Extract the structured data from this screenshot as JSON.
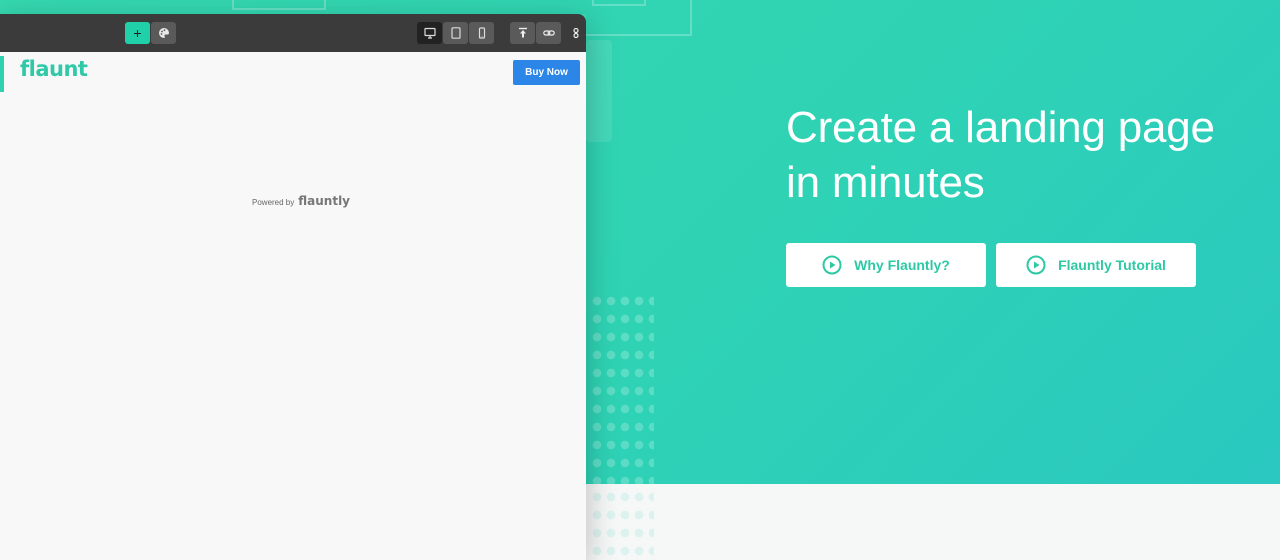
{
  "hero": {
    "headline_line1": "Create a landing page",
    "headline_line2": "in minutes",
    "buttons": [
      {
        "label": "Why Flauntly?",
        "icon": "play-circle-icon"
      },
      {
        "label": "Flauntly Tutorial",
        "icon": "play-circle-icon"
      }
    ],
    "accent_color": "#2dc9a5",
    "background_color": "#31d4b2"
  },
  "editor": {
    "toolbar": {
      "buttons": [
        {
          "name": "add-section",
          "glyph": "+",
          "icon": "plus-icon",
          "active": true
        },
        {
          "name": "theme-palette",
          "icon": "palette-icon"
        },
        {
          "name": "desktop-view",
          "icon": "desktop-icon",
          "active": true
        },
        {
          "name": "tablet-view",
          "icon": "tablet-icon"
        },
        {
          "name": "mobile-view",
          "icon": "mobile-icon"
        },
        {
          "name": "publish",
          "icon": "upload-icon"
        },
        {
          "name": "share-link",
          "icon": "link-icon"
        },
        {
          "name": "more",
          "icon": "more-icon"
        }
      ]
    },
    "page": {
      "logo_text": "flaunt",
      "buy_button_label": "Buy Now",
      "buy_button_color": "#2b86e8",
      "powered_by_prefix": "Powered by",
      "powered_by_brand": "flauntly"
    }
  }
}
